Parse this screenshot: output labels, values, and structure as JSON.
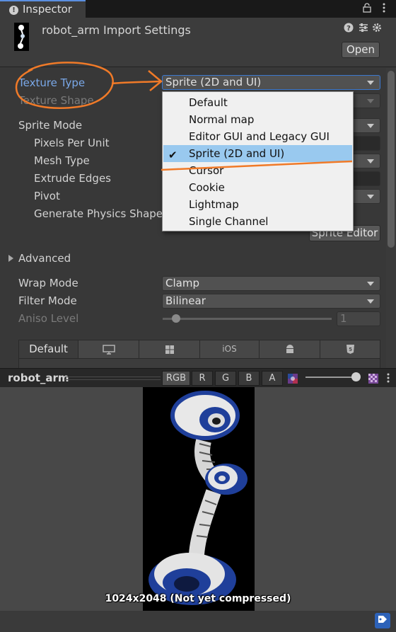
{
  "window": {
    "tab_label": "Inspector",
    "tab_icon": "info-icon",
    "toolbar_icons": [
      "lock-icon",
      "more-icon"
    ]
  },
  "header": {
    "title": "robot_arm Import Settings",
    "open_label": "Open",
    "icons": [
      "help-icon",
      "preset-icon",
      "settings-icon"
    ]
  },
  "properties": {
    "texture_type": {
      "label": "Texture Type",
      "value": "Sprite (2D and UI)"
    },
    "texture_shape": {
      "label": "Texture Shape"
    },
    "sprite_mode": {
      "label": "Sprite Mode"
    },
    "pixels_per_unit": {
      "label": "Pixels Per Unit"
    },
    "mesh_type": {
      "label": "Mesh Type"
    },
    "extrude_edges": {
      "label": "Extrude Edges"
    },
    "pivot": {
      "label": "Pivot"
    },
    "generate_physics_shape": {
      "label": "Generate Physics Shape"
    },
    "sprite_editor_label": "Sprite Editor",
    "advanced_label": "Advanced",
    "wrap_mode": {
      "label": "Wrap Mode",
      "value": "Clamp"
    },
    "filter_mode": {
      "label": "Filter Mode",
      "value": "Bilinear"
    },
    "aniso_level": {
      "label": "Aniso Level",
      "value": "1"
    }
  },
  "platform_tabs": {
    "default_label": "Default",
    "ios_label": "iOS",
    "icons": [
      "monitor-icon",
      "windows-icon",
      "android-icon",
      "html5-icon"
    ]
  },
  "dropdown": {
    "items": [
      {
        "label": "Default",
        "selected": false
      },
      {
        "label": "Normal map",
        "selected": false
      },
      {
        "label": "Editor GUI and Legacy GUI",
        "selected": false
      },
      {
        "label": "Sprite (2D and UI)",
        "selected": true
      },
      {
        "label": "Cursor",
        "selected": false
      },
      {
        "label": "Cookie",
        "selected": false
      },
      {
        "label": "Lightmap",
        "selected": false
      },
      {
        "label": "Single Channel",
        "selected": false
      }
    ],
    "check_glyph": "✔"
  },
  "preview": {
    "name": "robot_arm",
    "channels": [
      "RGB",
      "R",
      "G",
      "B",
      "A"
    ],
    "active_channel": "RGB",
    "caption": "1024x2048 (Not yet compressed)"
  },
  "colors": {
    "accent_blue": "#7aa8e8",
    "annotation_orange": "#f07a28",
    "selection": "#99c9ef"
  }
}
